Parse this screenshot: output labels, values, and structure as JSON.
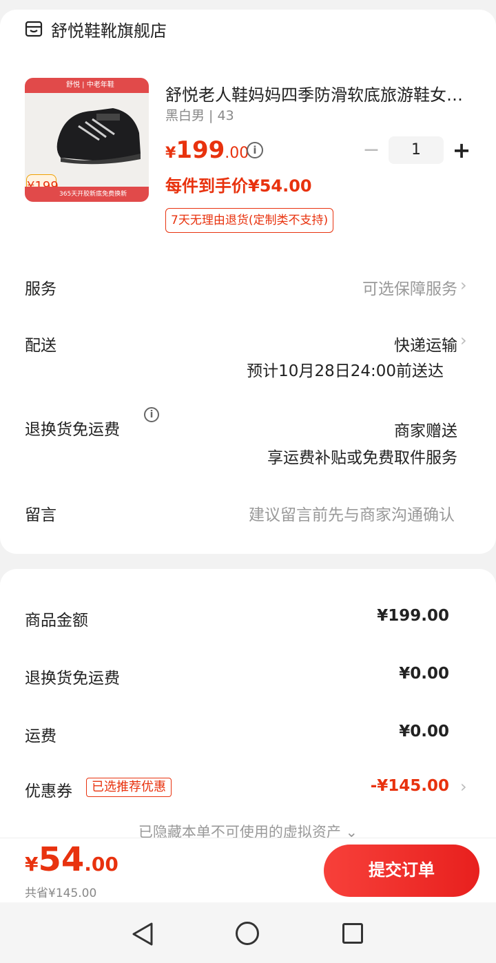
{
  "shop": {
    "name": "舒悦鞋靴旗舰店",
    "icon": "store-icon"
  },
  "product": {
    "title": "舒悦老人鞋妈妈四季防滑软底旅游鞋女款老年健步鞋",
    "spec": "黑白男 | 43",
    "price_currency": "¥",
    "price_int": "199",
    "price_dec": ".00",
    "final_price": "每件到手价¥54.00",
    "return_policy": "7天无理由退货(定制类不支持)",
    "quantity": "1",
    "image": {
      "top_brand": "舒悦 | 中老年鞋",
      "price_tag": "¥199",
      "banner": "365天开胶新底免费换新"
    }
  },
  "service": {
    "label": "服务",
    "value": "可选保障服务"
  },
  "delivery": {
    "label": "配送",
    "method": "快递运输",
    "eta": "预计10月28日24:00前送达"
  },
  "return_shipping": {
    "label": "退换货免运费",
    "value": "商家赠送",
    "desc": "享运费补贴或免费取件服务"
  },
  "message": {
    "label": "留言",
    "placeholder": "建议留言前先与商家沟通确认"
  },
  "summary": {
    "goods_label": "商品金额",
    "goods_value": "¥199.00",
    "return_label": "退换货免运费",
    "return_value": "¥0.00",
    "shipping_label": "运费",
    "shipping_value": "¥0.00",
    "coupon_label": "优惠券",
    "coupon_badge": "已选推荐优惠",
    "coupon_value": "-¥145.00",
    "hidden_note": "已隐藏本单不可使用的虚拟资产 ⌄"
  },
  "footer": {
    "total_currency": "¥",
    "total_int": "54",
    "total_dec": ".00",
    "saved": "共省¥145.00",
    "submit": "提交订单"
  },
  "colors": {
    "accent": "#e8320e",
    "button": "#f0302c"
  }
}
